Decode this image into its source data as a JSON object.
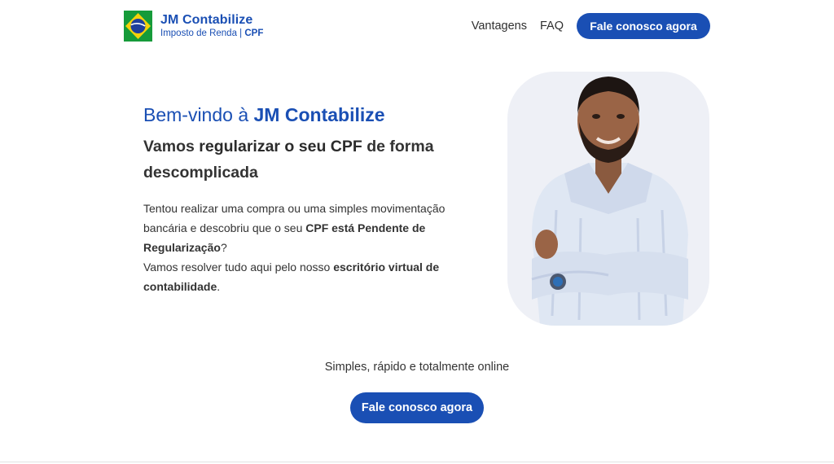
{
  "header": {
    "brand_name": "JM Contabilize",
    "brand_sub_prefix": "Imposto de Renda | ",
    "brand_sub_bold": "CPF",
    "logo_icon": "brazil-flag-logo-icon",
    "nav": [
      {
        "label": "Vantagens"
      },
      {
        "label": "FAQ"
      }
    ],
    "cta_label": "Fale conosco agora"
  },
  "hero": {
    "welcome_prefix": "Bem-vindo à ",
    "welcome_bold": "JM Contabilize",
    "headline_prefix": "Vamos ",
    "headline_bold": "regularizar o seu CPF",
    "headline_suffix": " de forma descomplicada",
    "para1_prefix": "Tentou realizar uma compra ou uma simples movimentação bancária e descobriu que o seu ",
    "para1_bold": "CPF está Pendente de Regularização",
    "para1_suffix": "?",
    "para2_prefix": "Vamos resolver tudo aqui pelo nosso ",
    "para2_bold": "escritório virtual de contabilidade",
    "para2_suffix": "."
  },
  "cta": {
    "tagline": "Simples, rápido e totalmente online",
    "button_label": "Fale conosco agora"
  },
  "colors": {
    "brand_blue": "#1a4fb4",
    "text_dark": "#2b2b2b",
    "portrait_bg": "#eef0f6",
    "flag_green": "#169b3a",
    "flag_yellow": "#f5d20a"
  }
}
